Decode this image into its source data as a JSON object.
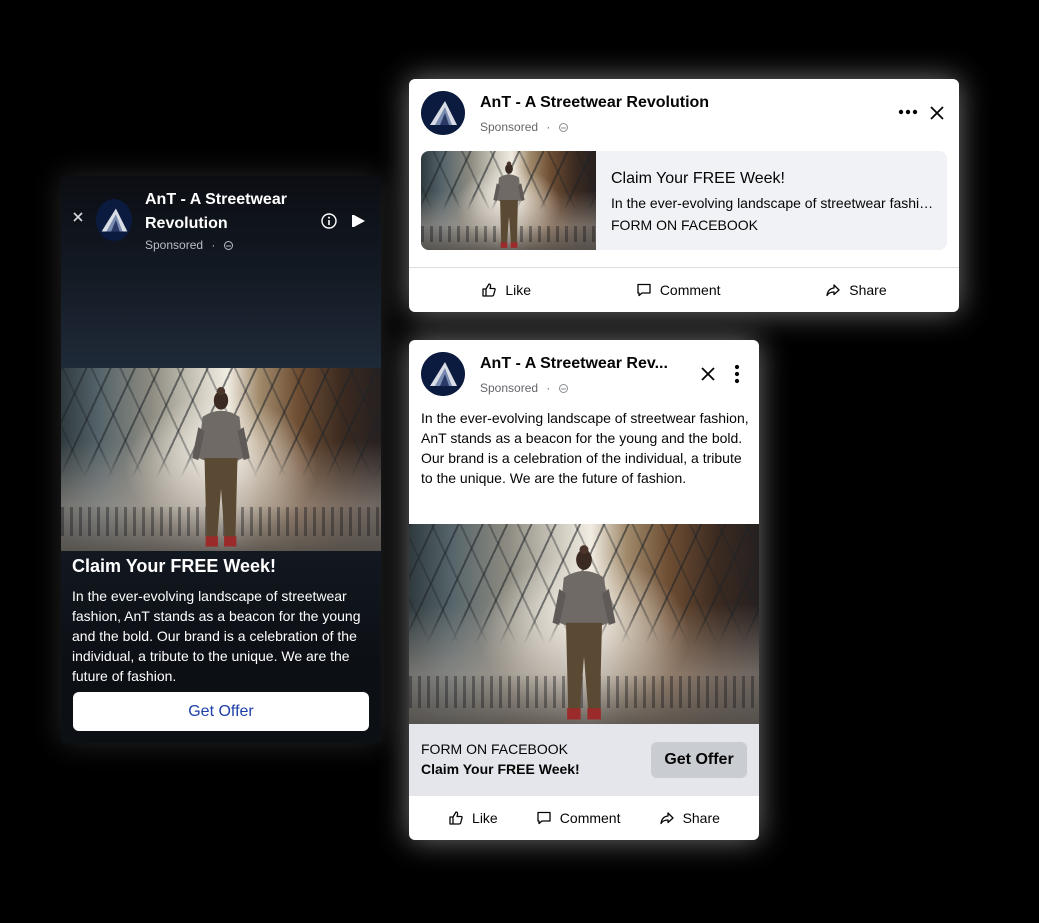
{
  "brand": "AnT - A Streetwear Revolution",
  "brand_truncated": "AnT - A Streetwear Rev...",
  "sponsored": "Sponsored",
  "dot": "·",
  "offer_title": "Claim Your FREE Week!",
  "description": "In the ever-evolving landscape of streetwear fashion, AnT stands as a beacon for the young and the bold. Our brand is a celebration of the individual, a tribute to the unique. We are the future of fashion.",
  "description_short": "In the ever-evolving landscape of streetwear fashion, AnT stands as a beacon for the young and the bold.",
  "form_label": "FORM ON FACEBOOK",
  "cta_label": "Get Offer",
  "actions": {
    "like": "Like",
    "comment": "Comment",
    "share": "Share"
  },
  "icons": [
    "close-icon",
    "info-icon",
    "play-icon",
    "globe-icon",
    "more-icon",
    "kebab-icon",
    "like-icon",
    "comment-icon",
    "share-icon"
  ],
  "colors": {
    "page_bg": "#000000",
    "cta_text": "#1d3fa8",
    "footer_bg": "#e4e6eb",
    "cta_gray": "#c9ccd1"
  }
}
